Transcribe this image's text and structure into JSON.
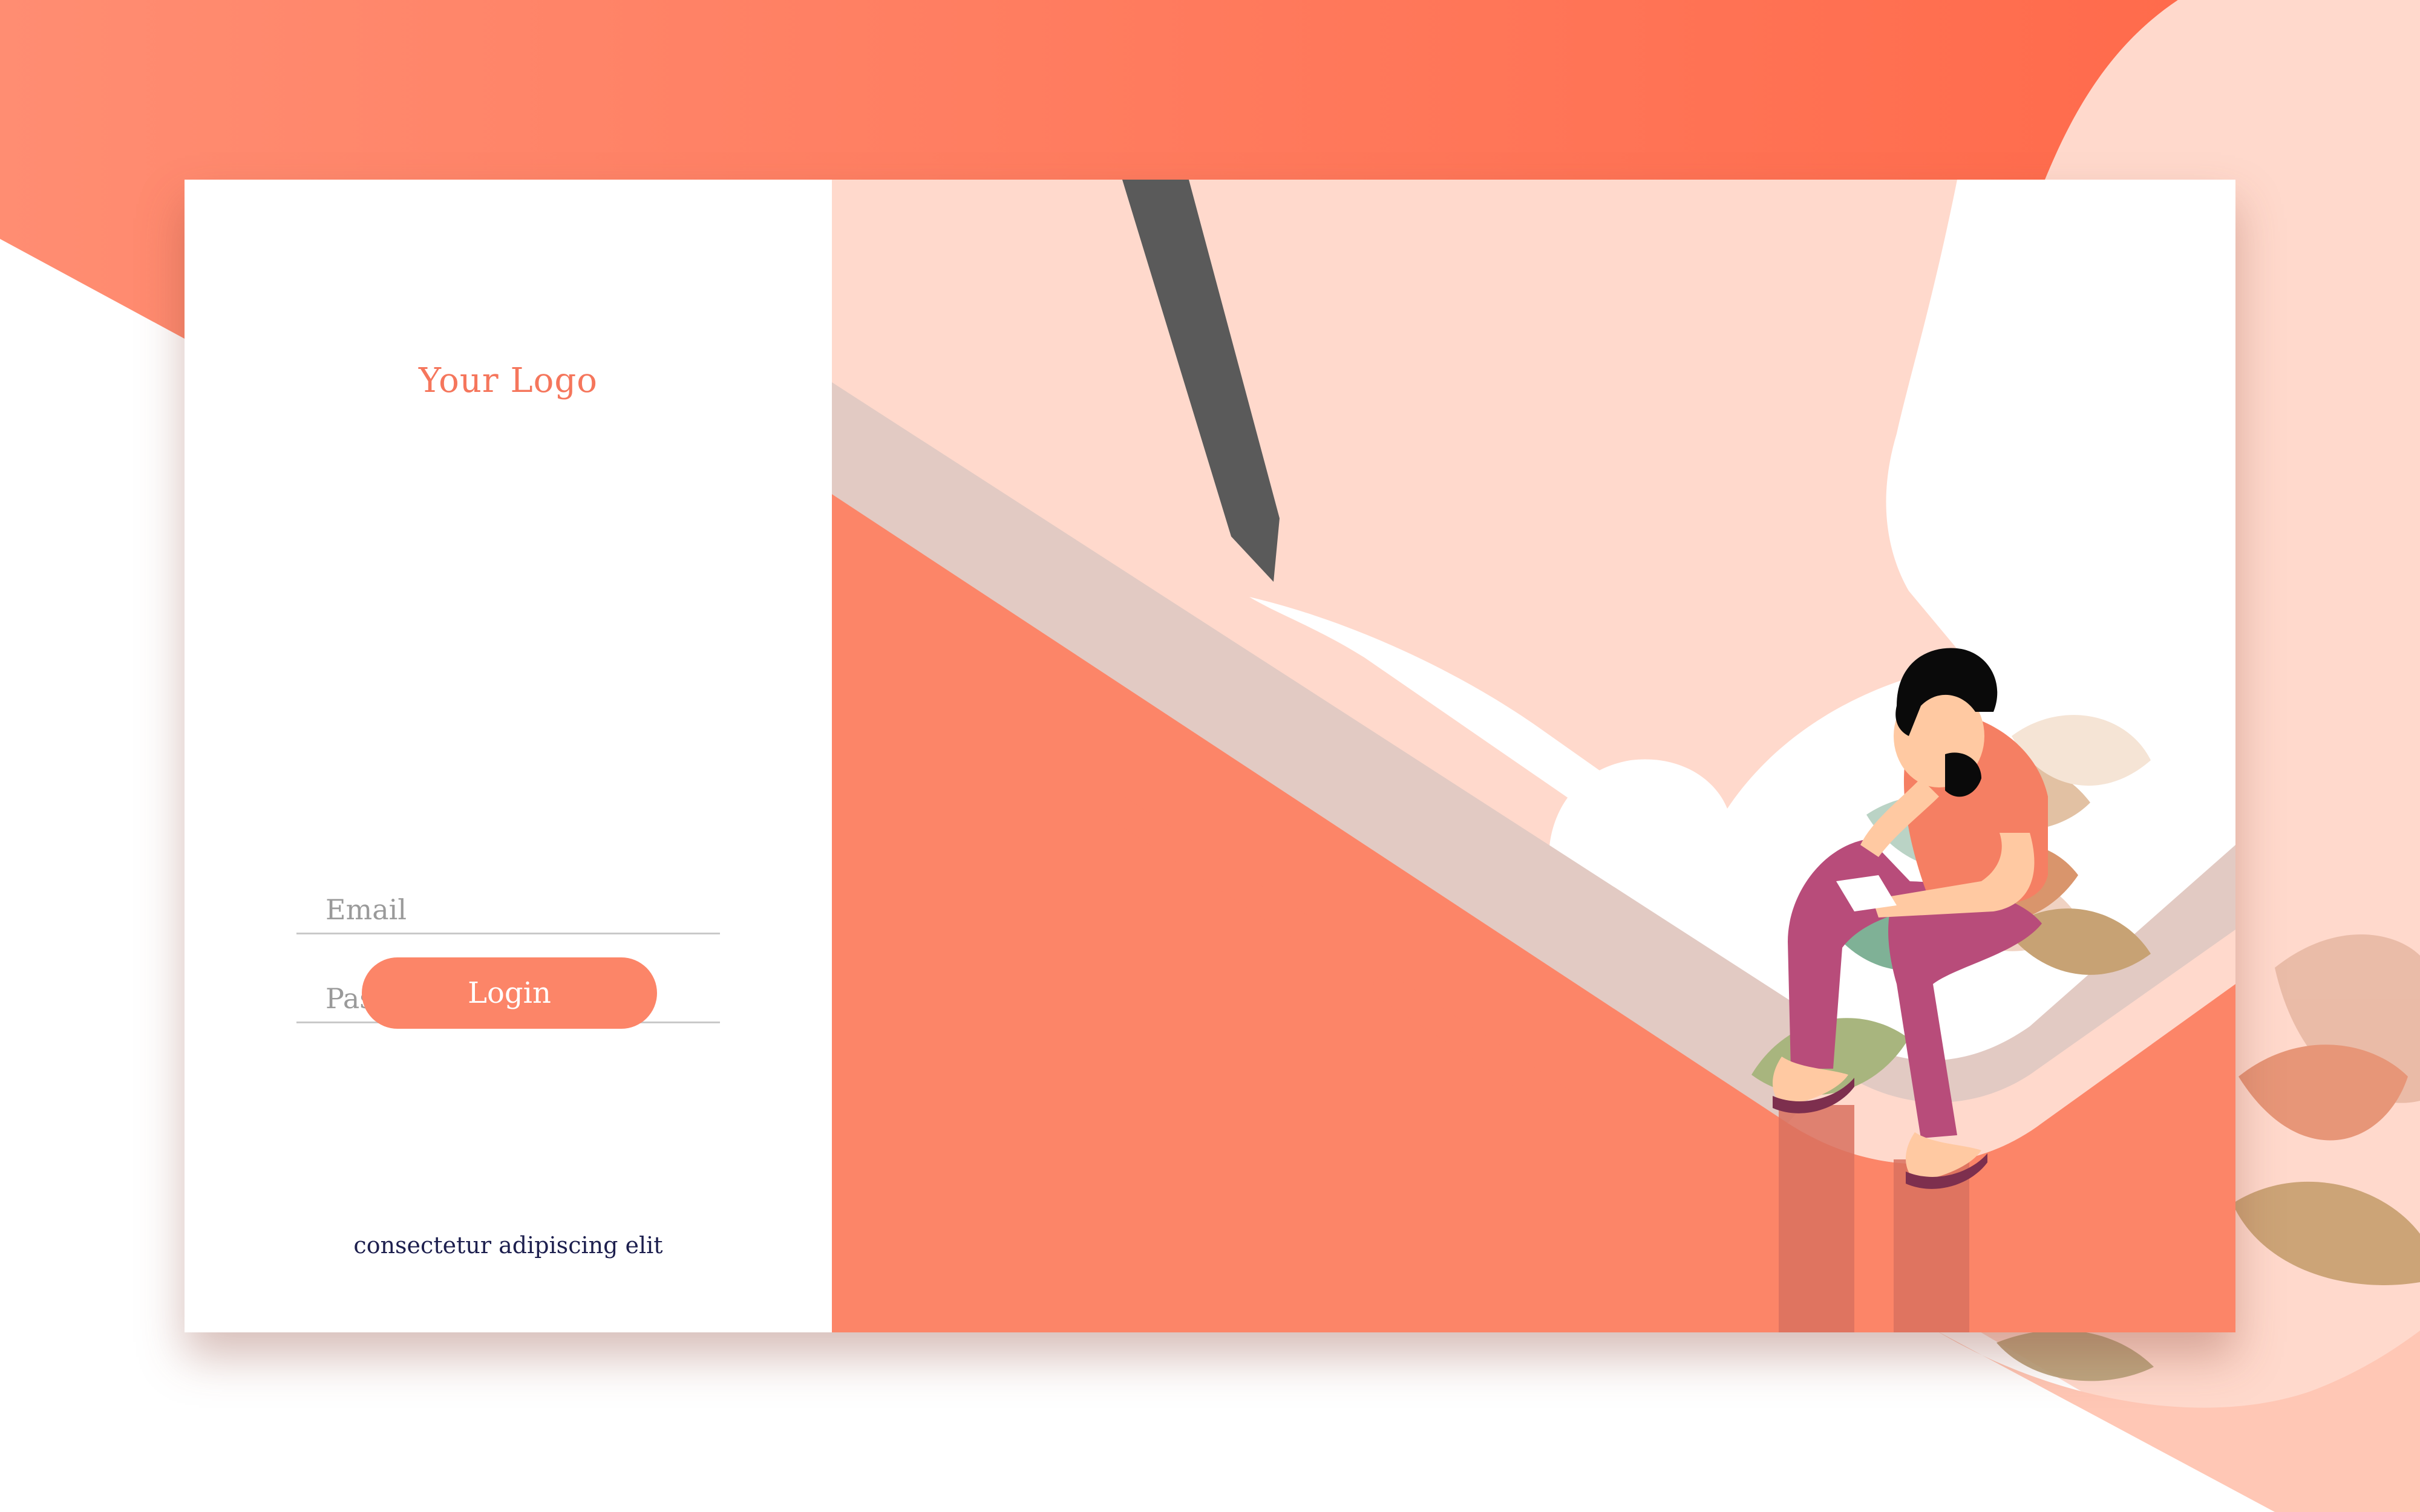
{
  "brand": {
    "logo_text": "Your Logo"
  },
  "login_form": {
    "email_placeholder": "Email",
    "password_placeholder": "Password",
    "login_label": "Login"
  },
  "footer": {
    "tagline": "consectetur adipiscing elit"
  },
  "colors": {
    "accent": "#fc8568",
    "accent_dark": "#ff6a47",
    "blush": "#ffd9cc",
    "text_dark": "#1d1f4e"
  }
}
